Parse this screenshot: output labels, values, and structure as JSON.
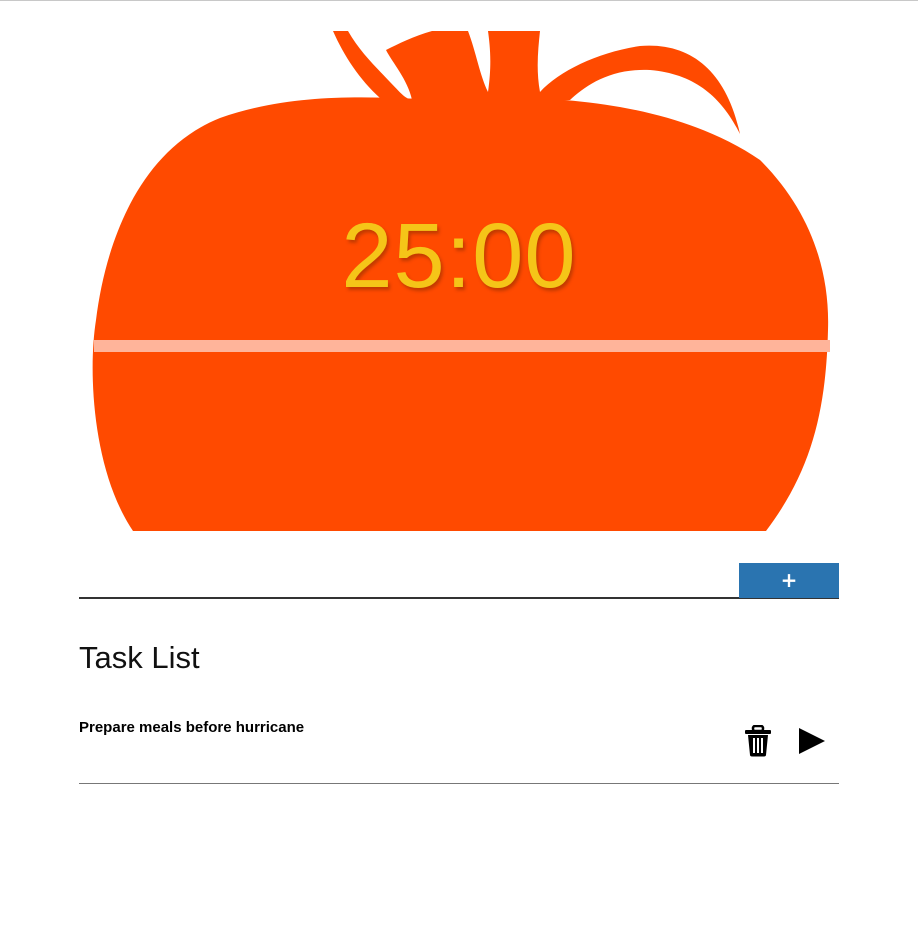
{
  "timer": {
    "display": "25:00"
  },
  "new_task": {
    "value": "",
    "placeholder": "",
    "add_label": "+"
  },
  "task_list": {
    "heading": "Task List",
    "items": [
      {
        "text": "Prepare meals before hurricane",
        "delete_icon": "trash-icon",
        "start_icon": "play-icon"
      }
    ]
  },
  "colors": {
    "tomato": "#ff4a00",
    "timer_text": "#f5c518",
    "stripe": "#ffb49a",
    "add_button": "#2a74b0"
  }
}
